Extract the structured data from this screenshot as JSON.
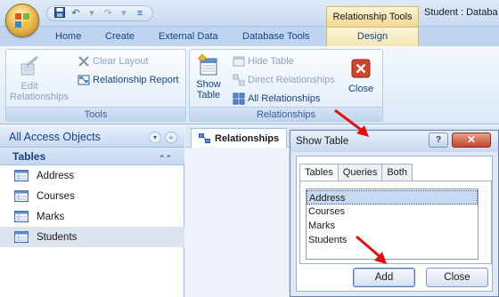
{
  "window": {
    "quick_access": [
      "save-icon",
      "undo-icon",
      "redo-icon"
    ],
    "contextual_tab": "Relationship Tools",
    "document_title": "Student : Databa"
  },
  "ribbon": {
    "tabs": [
      "Home",
      "Create",
      "External Data",
      "Database Tools",
      "Design"
    ],
    "active_tab": "Design",
    "tools_group": {
      "label": "Tools",
      "edit_relationships": "Edit Relationships",
      "clear_layout": "Clear Layout",
      "relationship_report": "Relationship Report"
    },
    "relationships_group": {
      "label": "Relationships",
      "show_table_line1": "Show",
      "show_table_line2": "Table",
      "hide_table": "Hide Table",
      "direct_relationships": "Direct Relationships",
      "all_relationships": "All Relationships",
      "close": "Close"
    }
  },
  "nav": {
    "header": "All Access Objects",
    "group": "Tables",
    "items": [
      "Address",
      "Courses",
      "Marks",
      "Students"
    ],
    "selected": "Students"
  },
  "document_tab": "Relationships",
  "dialog": {
    "title": "Show Table",
    "help": "?",
    "tabs": [
      "Tables",
      "Queries",
      "Both"
    ],
    "active_tab": "Tables",
    "list": [
      "Address",
      "Courses",
      "Marks",
      "Students"
    ],
    "selected": "Address",
    "add_button": "Add",
    "close_button": "Close"
  },
  "colors": {
    "ribbon_accent": "#15428b",
    "arrow_red": "#e01010",
    "close_red": "#c4442a"
  }
}
